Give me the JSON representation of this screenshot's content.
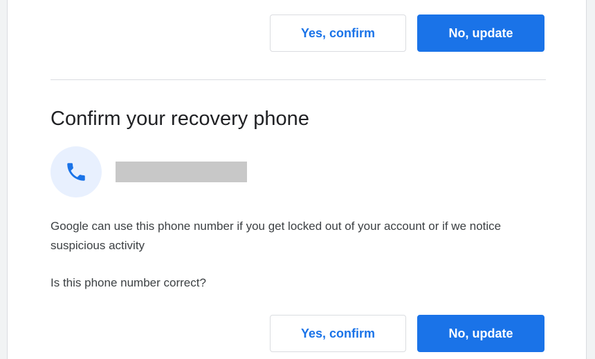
{
  "top_actions": {
    "confirm_label": "Yes, confirm",
    "update_label": "No, update"
  },
  "recovery_phone": {
    "title": "Confirm your recovery phone",
    "icon": "phone-icon",
    "description": "Google can use this phone number if you get locked out of your account or if we notice suspicious activity",
    "question": "Is this phone number correct?",
    "confirm_label": "Yes, confirm",
    "update_label": "No, update"
  },
  "colors": {
    "accent": "#1a73e8",
    "icon_bg": "#e8f0fe",
    "divider": "#dadce0",
    "redaction": "#c8c8c8"
  }
}
